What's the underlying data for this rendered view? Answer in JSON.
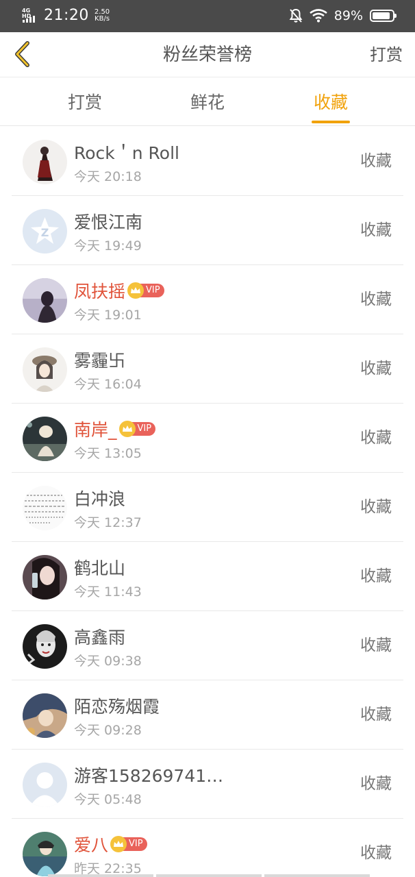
{
  "status_bar": {
    "network": "4G HD",
    "time": "21:20",
    "speed_value": "2.50",
    "speed_unit": "KB/s",
    "battery_percent": "89%",
    "battery_level": 0.89
  },
  "header": {
    "title": "粉丝荣誉榜",
    "action": "打赏",
    "back_icon": "chevron-left-icon",
    "accent_color": "#f1a20b"
  },
  "tabs": [
    {
      "label": "打赏",
      "active": false
    },
    {
      "label": "鲜花",
      "active": false
    },
    {
      "label": "收藏",
      "active": true
    }
  ],
  "fans": [
    {
      "name": "Rock＇n Roll",
      "time": "今天 20:18",
      "action": "收藏",
      "vip": false
    },
    {
      "name": "爱恨江南",
      "time": "今天 19:49",
      "action": "收藏",
      "vip": false
    },
    {
      "name": "凤扶摇",
      "time": "今天 19:01",
      "action": "收藏",
      "vip": true,
      "badge": "VIP"
    },
    {
      "name": "雾霾卐",
      "time": "今天 16:04",
      "action": "收藏",
      "vip": false
    },
    {
      "name": "南岸_",
      "time": "今天 13:05",
      "action": "收藏",
      "vip": true,
      "badge": "VIP"
    },
    {
      "name": "白冲浪",
      "time": "今天 12:37",
      "action": "收藏",
      "vip": false
    },
    {
      "name": "鹤北山",
      "time": "今天 11:43",
      "action": "收藏",
      "vip": false
    },
    {
      "name": "高鑫雨",
      "time": "今天 09:38",
      "action": "收藏",
      "vip": false
    },
    {
      "name": "陌恋殇烟霞",
      "time": "今天 09:28",
      "action": "收藏",
      "vip": false
    },
    {
      "name": "游客158269741…",
      "time": "今天 05:48",
      "action": "收藏",
      "vip": false
    },
    {
      "name": "爱八",
      "time": "昨天 22:35",
      "action": "收藏",
      "vip": true,
      "badge": "VIP"
    }
  ]
}
